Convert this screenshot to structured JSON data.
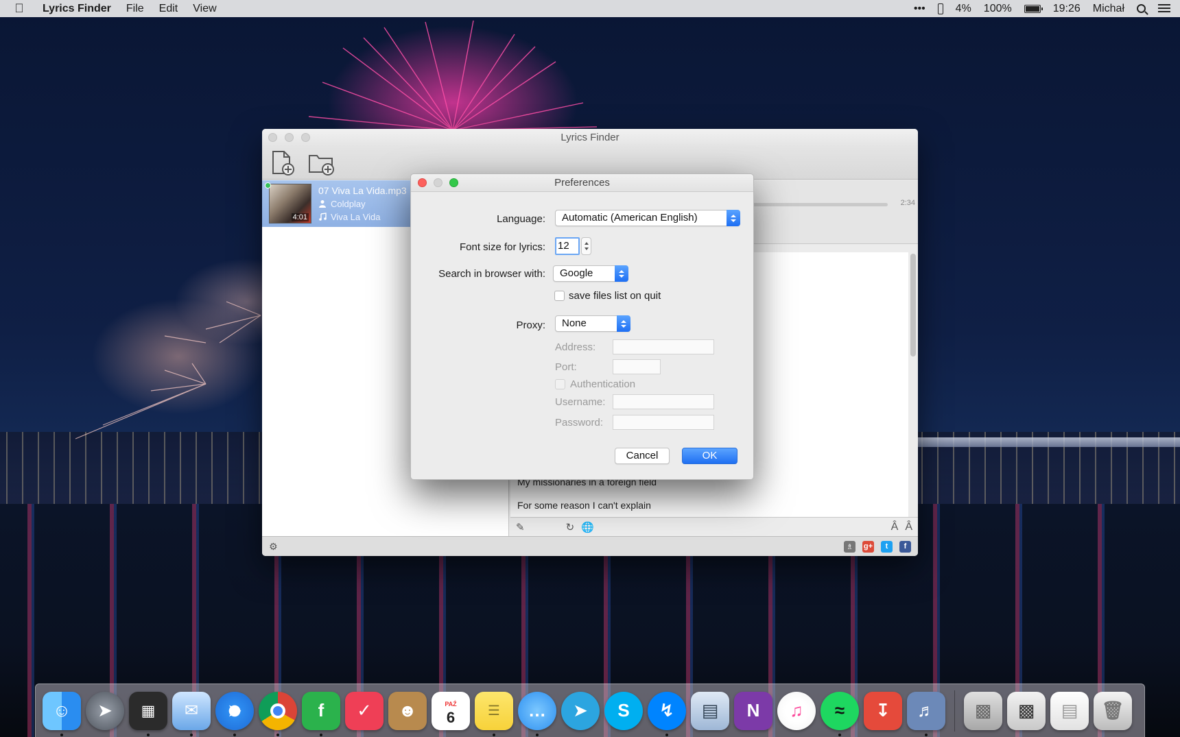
{
  "menubar": {
    "app_name": "Lyrics Finder",
    "menus": [
      "File",
      "Edit",
      "View"
    ],
    "status": {
      "more": "•••",
      "battery_percent_small": "4%",
      "battery_percent": "100%",
      "time": "19:26",
      "user": "Michał"
    }
  },
  "main_window": {
    "title": "Lyrics Finder",
    "track": {
      "filename": "07 Viva La Vida.mp3",
      "artist": "Coldplay",
      "album": "Viva La Vida",
      "duration": "4:01"
    },
    "elapsed": "2:34",
    "lyrics_lines": [
      "My missionaries in a foreign field",
      "For some reason I can't explain"
    ]
  },
  "preferences": {
    "title": "Preferences",
    "language_label": "Language:",
    "language_value": "Automatic (American English)",
    "font_size_label": "Font size for lyrics:",
    "font_size_value": "12",
    "search_label": "Search in browser with:",
    "search_value": "Google",
    "save_files_label": "save files list on quit",
    "save_files_checked": false,
    "proxy_label": "Proxy:",
    "proxy_value": "None",
    "address_label": "Address:",
    "port_label": "Port:",
    "authentication_label": "Authentication",
    "username_label": "Username:",
    "password_label": "Password:",
    "cancel_label": "Cancel",
    "ok_label": "OK"
  },
  "dock": {
    "calendar_month": "PAŹ",
    "calendar_day": "6",
    "apps": [
      "finder",
      "launchpad",
      "mission-control",
      "mail",
      "safari",
      "chrome",
      "feedly",
      "pocket",
      "contacts",
      "calendar",
      "notes",
      "messages",
      "telegram",
      "skype",
      "messenger",
      "preview",
      "onenote",
      "itunes",
      "spotify",
      "transmit",
      "lyrics-finder",
      "downloads",
      "documents",
      "stack",
      "trash"
    ]
  },
  "colors": {
    "accent_blue": "#1f6ff2",
    "close_red": "#fc605c",
    "zoom_green": "#34c84a",
    "selection_blue": "#9bbbe9"
  }
}
